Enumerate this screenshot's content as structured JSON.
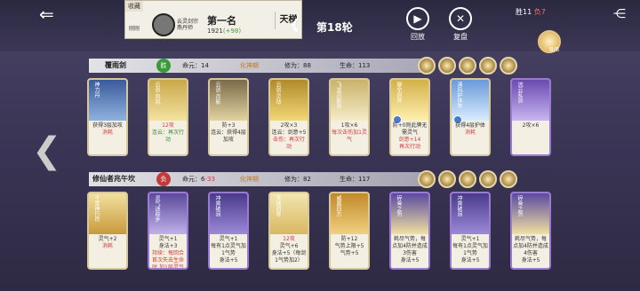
{
  "topbar": {
    "rank_header": "收藏",
    "rank_subtext": "刚刚",
    "player_name_line1": "云灵剑宗",
    "player_name_line2": "燕丹师",
    "rank_title": "第一名",
    "rank_score": "1921",
    "rank_delta": "(+98)",
    "ladder_button": "天梯",
    "round_label": "第18轮",
    "replay_label": "回放",
    "review_label": "复盘",
    "win_label": "胜11",
    "loss_label": "负7",
    "badge_label": "8/8"
  },
  "players": [
    {
      "name": "覆雨剑",
      "result_badge": "胜",
      "life_label": "命元：14",
      "realm": "化神期",
      "cultivation": "修为：88",
      "hp": "生命：113",
      "cards": [
        {
          "name": "神力丹",
          "desc_lines": [
            "获得3层加攻",
            "消耗"
          ]
        },
        {
          "name": "云剑·凤风",
          "desc_lines": [
            "12攻",
            "连云：再次行动"
          ]
        },
        {
          "name": "云剑·月影",
          "desc_lines": [
            "防+3",
            "连云：获得4层加攻"
          ]
        },
        {
          "name": "云剑·灵动",
          "desc_lines": [
            "2攻×3",
            "连云：剑意+5",
            "击伤：再次行动"
          ]
        },
        {
          "name": "飞龙闪影剑",
          "desc_lines": [
            "1攻×6",
            "每次击伤加1灵气"
          ]
        },
        {
          "name": "御空剑阵",
          "desc_lines": [
            "防+0则此牌无需灵气",
            "剑意+14",
            "再次行动"
          ]
        },
        {
          "name": "清风护体阵",
          "desc_lines": [
            "获得4层护体",
            "消耗"
          ]
        },
        {
          "name": "流云乱剑",
          "desc_lines": [
            "2攻×6"
          ]
        }
      ]
    },
    {
      "name": "修仙者兆午坎",
      "result_badge": "负",
      "life_label": "命元：6",
      "life_delta": "-33",
      "realm": "化神期",
      "cultivation": "修为：82",
      "hp": "生命：117",
      "cards": [
        {
          "name": "千里神行符",
          "desc_lines": [
            "灵气+2",
            "消耗"
          ]
        },
        {
          "name": "灵气迷踪步",
          "desc_lines": [
            "灵气+1",
            "身法+3",
            "持续：每回合首次失去生命时,加1层灵气和身法"
          ]
        },
        {
          "name": "冲霄破浪",
          "desc_lines": [
            "灵气+1",
            "每有1点灵气加1气势",
            "身法+5"
          ]
        },
        {
          "name": "天地同寿",
          "desc_lines": [
            "12攻",
            "灵气+6",
            "身法+5（每剑1气势加2）"
          ]
        },
        {
          "name": "威震四方",
          "desc_lines": [
            "防+12",
            "气势上限+5",
            "气势+5"
          ]
        },
        {
          "name": "碎骨之势",
          "desc_lines": [
            "耗尽气势，每点加4防并造成3伤害",
            "身法+5"
          ]
        },
        {
          "name": "冲霄破浪",
          "desc_lines": [
            "灵气+1",
            "每有1点灵气加1气势",
            "身法+5"
          ]
        },
        {
          "name": "碎骨之势",
          "desc_lines": [
            "耗尽气势，每点加4防并造成4伤害",
            "身法+5"
          ]
        }
      ]
    }
  ],
  "colors": {
    "win": "#3a9a3a",
    "loss": "#c23a3a",
    "realm": "#c47a1a"
  }
}
